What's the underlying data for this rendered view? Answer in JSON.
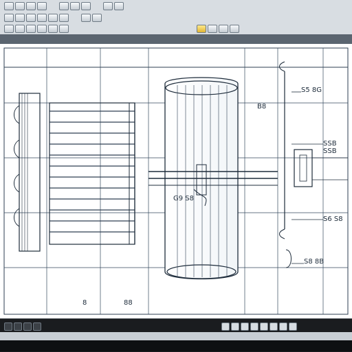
{
  "app": {
    "window_title": "",
    "ribbon_text": ""
  },
  "toolbar": {
    "buttons": [
      {
        "name": "new-icon"
      },
      {
        "name": "open-icon"
      },
      {
        "name": "save-icon"
      },
      {
        "name": "print-icon"
      },
      {
        "name": "cut-icon"
      },
      {
        "name": "copy-icon"
      },
      {
        "name": "paste-icon"
      },
      {
        "name": "undo-icon"
      },
      {
        "name": "redo-icon"
      },
      {
        "name": "zoom-icon"
      },
      {
        "name": "pan-icon"
      },
      {
        "name": "grid-icon"
      }
    ]
  },
  "drawing": {
    "annotations": [
      {
        "text": "S5 8G"
      },
      {
        "text": "SSB SSB"
      },
      {
        "text": "S6 S8"
      },
      {
        "text": "S8 8B"
      },
      {
        "text": "G9 S8"
      },
      {
        "text": "88"
      },
      {
        "text": "B8"
      },
      {
        "text": "8"
      }
    ]
  },
  "status": {
    "icons": [
      "layer-icon",
      "snap-icon",
      "ortho-icon",
      "polar-icon",
      "osnap-icon",
      "lineweight-icon"
    ]
  }
}
